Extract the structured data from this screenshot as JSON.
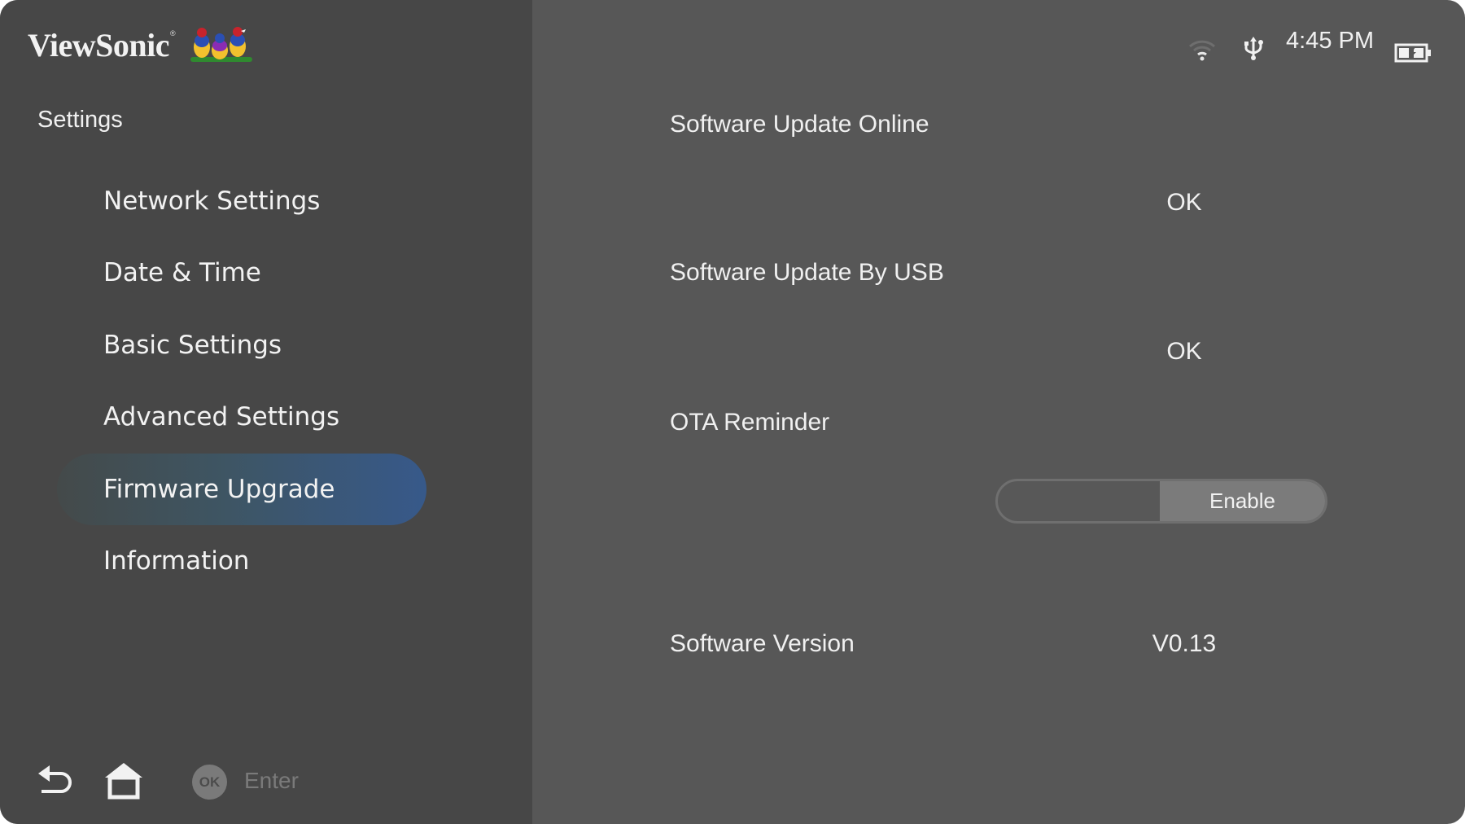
{
  "brand": {
    "name": "ViewSonic",
    "registered": "®",
    "mascot": "birds-logo"
  },
  "status_bar": {
    "wifi_icon": "wifi-icon",
    "usb_icon": "usb-icon",
    "time": "4:45 PM",
    "battery_icon": "battery-charging-icon"
  },
  "sidebar": {
    "title": "Settings",
    "items": [
      {
        "label": "Network Settings",
        "active": false
      },
      {
        "label": "Date & Time",
        "active": false
      },
      {
        "label": "Basic Settings",
        "active": false
      },
      {
        "label": "Advanced Settings",
        "active": false
      },
      {
        "label": "Firmware Upgrade",
        "active": true
      },
      {
        "label": "Information",
        "active": false
      }
    ],
    "accent_gradient": [
      "#444a4a",
      "#37598a"
    ]
  },
  "bottom_bar": {
    "back_icon": "back-arrow-icon",
    "home_icon": "home-icon",
    "ok_badge": "OK",
    "enter_label": "Enter"
  },
  "main": {
    "rows": [
      {
        "label": "Software Update Online",
        "value": "OK"
      },
      {
        "label": "Software Update By USB",
        "value": "OK"
      },
      {
        "label": "OTA Reminder",
        "toggle_label": "Enable",
        "toggle_state": "Enable"
      },
      {
        "label": "Software Version",
        "value": "V0.13"
      }
    ]
  }
}
